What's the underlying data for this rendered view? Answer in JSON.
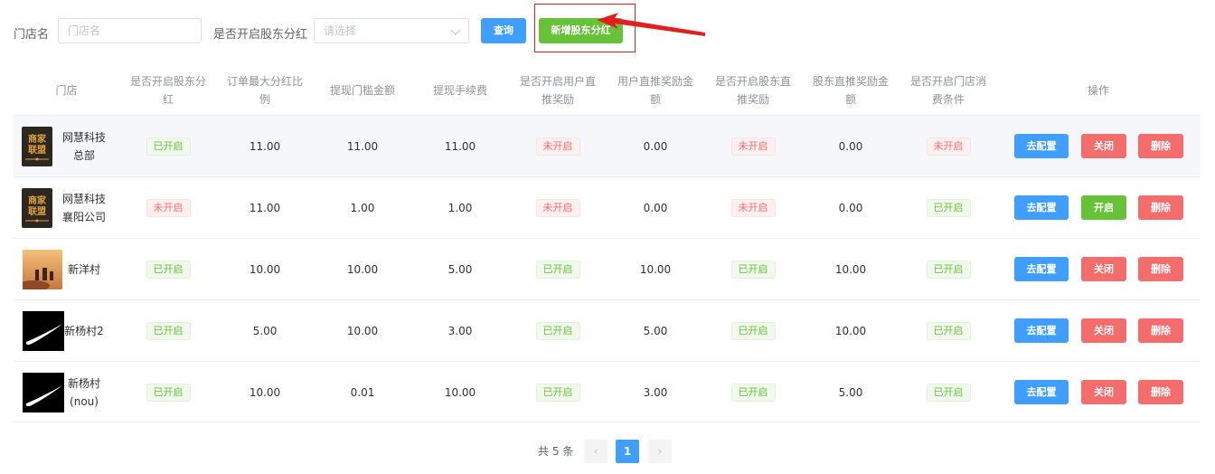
{
  "filters": {
    "store_label": "门店名",
    "store_placeholder": "门店名",
    "dividend_label": "是否开启股东分红",
    "dividend_placeholder": "请选择",
    "query_button": "查询",
    "add_button": "新增股东分红"
  },
  "table": {
    "headers": {
      "store": "门店",
      "dividend_enabled": "是否开启股东分红",
      "max_ratio": "订单最大分红比例",
      "withdraw_threshold": "提现门槛金额",
      "withdraw_fee": "提现手续费",
      "user_referral": "是否开启用户直推奖励",
      "user_referral_amount": "用户直推奖励金额",
      "holder_referral": "是否开启股东直推奖励",
      "holder_referral_amount": "股东直推奖励金额",
      "store_consume": "是否开启门店消费条件",
      "actions": "操作"
    },
    "rows": [
      {
        "logo": "merchant-alliance-logo",
        "store": "网慧科技总部",
        "dividend_enabled": "已开启",
        "max_ratio": "11.00",
        "withdraw_threshold": "11.00",
        "withdraw_fee": "11.00",
        "user_referral": "未开启",
        "user_referral_amount": "0.00",
        "holder_referral": "未开启",
        "holder_referral_amount": "0.00",
        "store_consume": "未开启",
        "edit": "去配置",
        "toggle": "关闭",
        "delete": "删除"
      },
      {
        "logo": "merchant-alliance-logo",
        "store": "网慧科技襄阳公司",
        "dividend_enabled": "未开启",
        "max_ratio": "11.00",
        "withdraw_threshold": "1.00",
        "withdraw_fee": "1.00",
        "user_referral": "未开启",
        "user_referral_amount": "0.00",
        "holder_referral": "未开启",
        "holder_referral_amount": "0.00",
        "store_consume": "已开启",
        "edit": "去配置",
        "toggle": "开启",
        "delete": "删除"
      },
      {
        "logo": "desert-travelers-photo",
        "store": "新洋村",
        "dividend_enabled": "已开启",
        "max_ratio": "10.00",
        "withdraw_threshold": "10.00",
        "withdraw_fee": "5.00",
        "user_referral": "已开启",
        "user_referral_amount": "10.00",
        "holder_referral": "已开启",
        "holder_referral_amount": "10.00",
        "store_consume": "已开启",
        "edit": "去配置",
        "toggle": "关闭",
        "delete": "删除"
      },
      {
        "logo": "swoosh-logo",
        "store": "新杨村2",
        "dividend_enabled": "已开启",
        "max_ratio": "5.00",
        "withdraw_threshold": "10.00",
        "withdraw_fee": "3.00",
        "user_referral": "已开启",
        "user_referral_amount": "5.00",
        "holder_referral": "已开启",
        "holder_referral_amount": "10.00",
        "store_consume": "已开启",
        "edit": "去配置",
        "toggle": "关闭",
        "delete": "删除"
      },
      {
        "logo": "swoosh-logo",
        "store": "新杨村(nou)",
        "dividend_enabled": "已开启",
        "max_ratio": "10.00",
        "withdraw_threshold": "0.01",
        "withdraw_fee": "10.00",
        "user_referral": "已开启",
        "user_referral_amount": "3.00",
        "holder_referral": "已开启",
        "holder_referral_amount": "5.00",
        "store_consume": "已开启",
        "edit": "去配置",
        "toggle": "关闭",
        "delete": "删除"
      }
    ]
  },
  "pagination": {
    "total": "共 5 条",
    "prev": "‹",
    "current": "1",
    "next": "›"
  },
  "colors": {
    "primary": "#409eff",
    "success": "#67c23a",
    "danger": "#f56c6c",
    "annotation": "#e02020"
  }
}
